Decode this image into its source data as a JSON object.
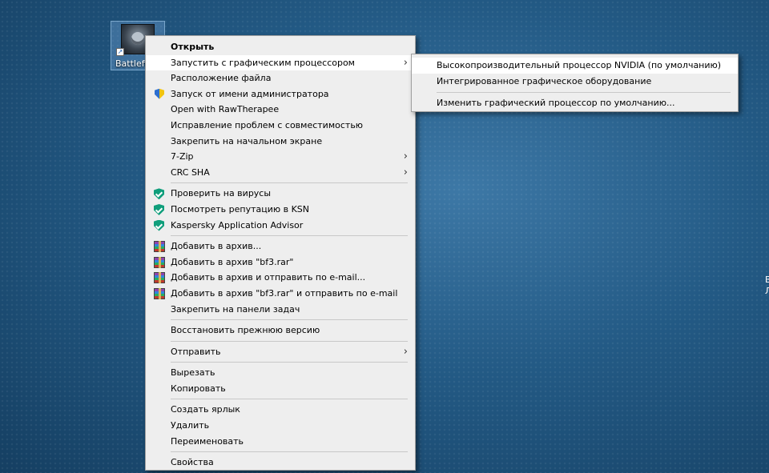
{
  "desktop": {
    "shortcut_label": "Battlefie",
    "edge_text_1": "В",
    "edge_text_2": "Л"
  },
  "context_menu": {
    "open": "Открыть",
    "run_with_gpu": "Запустить с графическим процессором",
    "file_location": "Расположение файла",
    "run_as_admin": "Запуск от имени администратора",
    "open_with_rawtherapee": "Open with RawTherapee",
    "troubleshoot_compat": "Исправление проблем с совместимостью",
    "pin_to_start": "Закрепить на начальном экране",
    "seven_zip": "7-Zip",
    "crc_sha": "CRC SHA",
    "scan_viruses": "Проверить на вирусы",
    "check_ksn": "Посмотреть репутацию в KSN",
    "kaspersky_advisor": "Kaspersky Application Advisor",
    "add_to_archive": "Добавить в архив...",
    "add_to_bf3": "Добавить в архив \"bf3.rar\"",
    "add_and_email": "Добавить в архив и отправить по e-mail...",
    "add_bf3_and_email": "Добавить в архив \"bf3.rar\" и отправить по e-mail",
    "pin_to_taskbar": "Закрепить на панели задач",
    "restore_previous": "Восстановить прежнюю версию",
    "send_to": "Отправить",
    "cut": "Вырезать",
    "copy": "Копировать",
    "create_shortcut": "Создать ярлык",
    "delete": "Удалить",
    "rename": "Переименовать",
    "properties": "Свойства"
  },
  "gpu_submenu": {
    "nvidia": "Высокопроизводительный процессор NVIDIA (по умолчанию)",
    "integrated": "Интегрированное графическое оборудование",
    "change_default": "Изменить графический процессор по умолчанию..."
  },
  "icons": {
    "submenu_arrow": "chevron-right-icon",
    "uac": "uac-shield-icon",
    "kaspersky": "kaspersky-shield-icon",
    "winrar": "winrar-icon"
  },
  "colors": {
    "menu_bg": "#eeeeee",
    "highlight": "#ffffff",
    "kaspersky_green": "#0f9e7b"
  }
}
